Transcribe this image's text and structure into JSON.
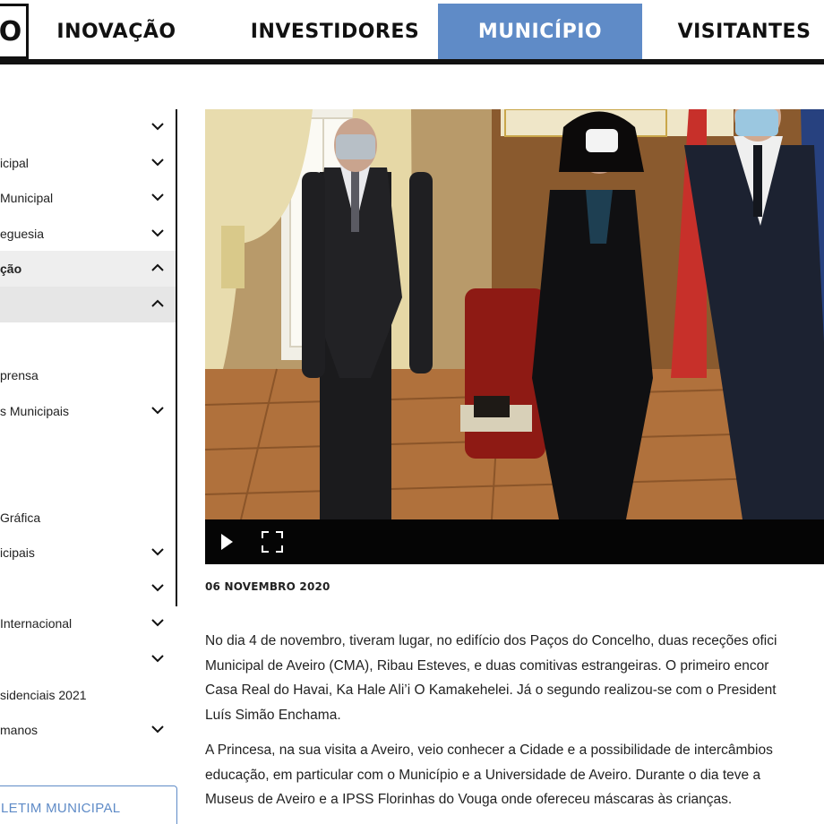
{
  "nav": {
    "logo_char": "O",
    "items": [
      {
        "label": "INOVAÇÃO",
        "active": false
      },
      {
        "label": "INVESTIDORES",
        "active": false
      },
      {
        "label": "MUNICÍPIO",
        "active": true
      },
      {
        "label": "VISITANTES",
        "active": false
      }
    ]
  },
  "sidebar": {
    "items": [
      {
        "label": "",
        "chevron": "down"
      },
      {
        "label": "icipal",
        "chevron": "down"
      },
      {
        "label": "Municipal",
        "chevron": "down"
      },
      {
        "label": "eguesia",
        "chevron": "down"
      },
      {
        "label": "ção",
        "chevron": "up"
      },
      {
        "label": "",
        "chevron": "up"
      },
      {
        "label": "",
        "chevron": "none"
      },
      {
        "label": "prensa",
        "chevron": "none"
      },
      {
        "label": "s Municipais",
        "chevron": "down"
      },
      {
        "label": "",
        "chevron": "none"
      },
      {
        "label": "",
        "chevron": "none"
      },
      {
        "label": "Gráfica",
        "chevron": "none"
      },
      {
        "label": "icipais",
        "chevron": "down"
      },
      {
        "label": "",
        "chevron": "down"
      },
      {
        "label": " Internacional",
        "chevron": "down"
      },
      {
        "label": "",
        "chevron": "down"
      },
      {
        "label": "sidenciais 2021",
        "chevron": "none"
      },
      {
        "label": "manos",
        "chevron": "down"
      }
    ],
    "boletim_label": "LETIM MUNICIPAL"
  },
  "article": {
    "date": "06 NOVEMBRO 2020",
    "para1": [
      "No dia 4 de novembro, tiveram lugar, no edifício dos Paços do Concelho, duas receções ofici",
      "Municipal de Aveiro (CMA), Ribau Esteves, e duas comitivas estrangeiras. O primeiro encor",
      "Casa Real do Havai, Ka Hale Ali’i O Kamakehelei. Já o segundo realizou-se com o President",
      "Luís Simão Enchama."
    ],
    "para2": [
      "A Princesa, na sua visita a Aveiro, veio conhecer a Cidade e a possibilidade de intercâmbios",
      "educação, em particular com o Município e a Universidade de Aveiro. Durante o dia teve a",
      "Museus de Aveiro e a IPSS Florinhas do Vouga onde ofereceu máscaras às crianças."
    ]
  },
  "colors": {
    "accent": "#5f8bc7",
    "nav_bar": "#111111",
    "sidebar_shade": "#eeeeee",
    "video_controls": "#050505"
  },
  "icons": {
    "play": "play-icon",
    "fullscreen": "fullscreen-icon",
    "chevron_down": "chevron-down-icon",
    "chevron_up": "chevron-up-icon"
  }
}
